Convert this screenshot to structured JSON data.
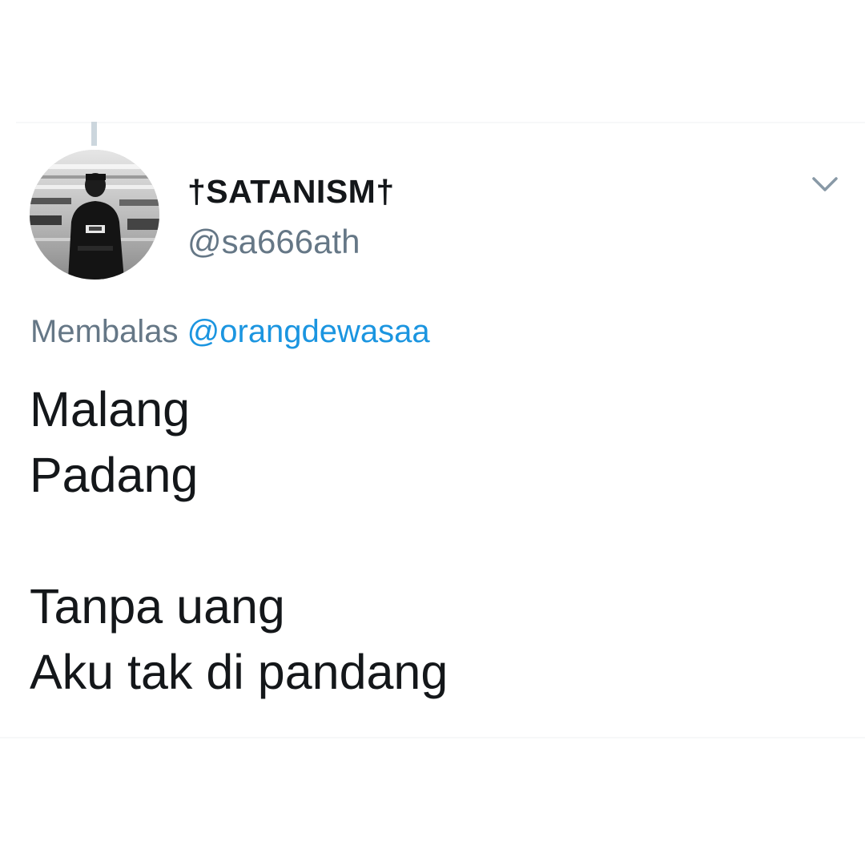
{
  "tweet": {
    "author": {
      "display_name": "†SATANISM†",
      "handle": "@sa666ath",
      "avatar_icon": "profile-photo"
    },
    "menu_icon": "chevron-down-icon",
    "reply": {
      "prefix": "Membalas",
      "mention": "@orangdewasaa"
    },
    "text_lines": [
      "Malang",
      "Padang",
      "Tanpa uang",
      "Aku tak di pandang"
    ]
  },
  "colors": {
    "text_primary": "#14171a",
    "text_secondary": "#657786",
    "link": "#1b95e0",
    "thread_line": "#ccd6dd"
  }
}
